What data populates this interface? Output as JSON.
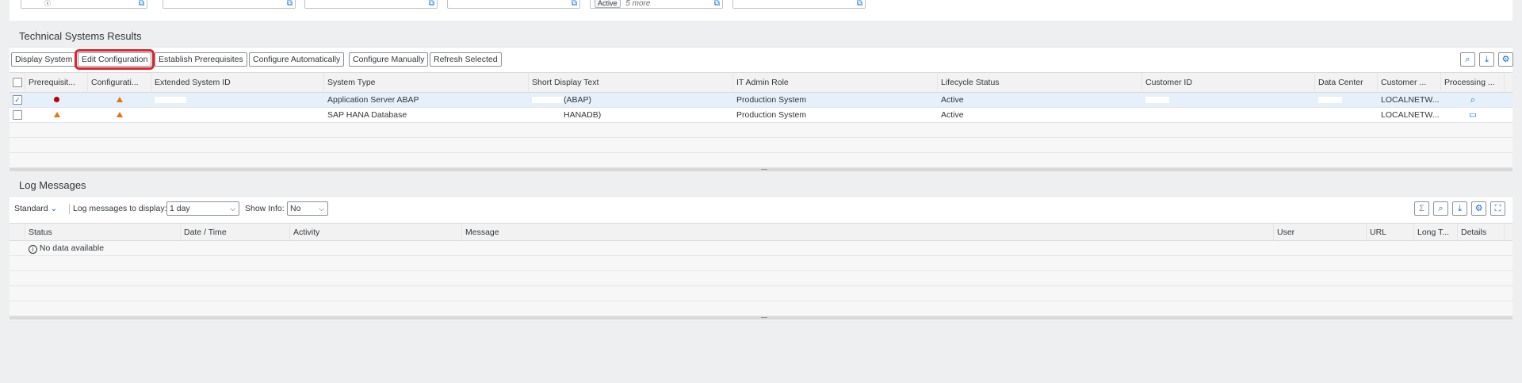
{
  "filterbar": {
    "fields": [
      {
        "token": "",
        "value": "",
        "more": ""
      },
      {
        "token": "",
        "value": "",
        "more": ""
      },
      {
        "token": "",
        "value": "",
        "more": ""
      },
      {
        "token": "",
        "value": "",
        "more": ""
      },
      {
        "token": "Active",
        "value": "",
        "more": "5 more"
      },
      {
        "token": "",
        "value": "",
        "more": ""
      }
    ]
  },
  "technical_systems": {
    "title": "Technical Systems Results",
    "toolbar": {
      "display_system": "Display System",
      "edit_configuration": "Edit Configuration",
      "establish_prerequisites": "Establish Prerequisites",
      "configure_automatically": "Configure Automatically",
      "configure_manually": "Configure Manually",
      "refresh_selected": "Refresh Selected"
    },
    "columns": [
      "Prerequisit...",
      "Configurati...",
      "Extended System ID",
      "System Type",
      "Short Display Text",
      "IT Admin Role",
      "Lifecycle Status",
      "Customer ID",
      "Data Center",
      "Customer ...",
      "Processing ..."
    ],
    "rows": [
      {
        "selected": true,
        "prereq": "error",
        "config": "warning",
        "ext_id": "",
        "system_type": "Application Server ABAP",
        "short_text": "(ABAP)",
        "it_role": "Production System",
        "lifecycle": "Active",
        "customer_id": "",
        "data_center": "",
        "customer": "LOCALNETW...",
        "processing": "search-icon"
      },
      {
        "selected": false,
        "prereq": "warning",
        "config": "warning",
        "ext_id": "",
        "system_type": "SAP HANA Database",
        "short_text": "HANADB)",
        "it_role": "Production System",
        "lifecycle": "Active",
        "customer_id": "",
        "data_center": "",
        "customer": "LOCALNETW...",
        "processing": "calendar-icon"
      }
    ]
  },
  "log_messages": {
    "title": "Log Messages",
    "variant": "Standard",
    "log_display_label": "Log messages to display:",
    "log_display_value": "1 day",
    "show_info_label": "Show Info:",
    "show_info_value": "No",
    "columns": [
      "Status",
      "Date / Time",
      "Activity",
      "Message",
      "User",
      "URL",
      "Long T...",
      "Details"
    ],
    "no_data": "No data available"
  },
  "colors": {
    "accent": "#0a6ed1",
    "highlight": "#e0242f",
    "error": "#bb0000",
    "warning": "#e9730c"
  }
}
